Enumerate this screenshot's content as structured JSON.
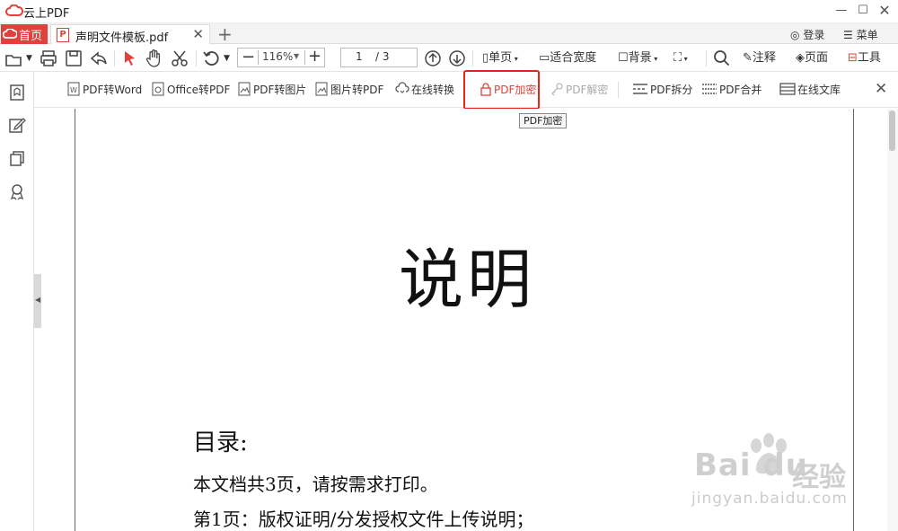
{
  "app": {
    "title": "云上PDF",
    "logo_icon": "cloud-logo-icon",
    "accent": "#e0413a"
  },
  "window": {
    "minimize_icon": "minimize-icon",
    "maximize_icon": "maximize-icon",
    "close_icon": "close-icon"
  },
  "tabs": {
    "home_label": "首页",
    "doc_label": "声明文件模板.pdf",
    "new_tab": "+",
    "login_label": "登录",
    "menu_label": "菜单"
  },
  "toolbar": {
    "zoom_value": "116%",
    "page_current": "1",
    "page_total": "/ 3",
    "single_page": "单页",
    "fit_width": "适合宽度",
    "background": "背景",
    "annotate": "注释",
    "page": "页面",
    "tools": "工具"
  },
  "subtoolbar": {
    "items": [
      {
        "label": "PDF转Word",
        "icon": "pdf-to-word-icon"
      },
      {
        "label": "Office转PDF",
        "icon": "office-to-pdf-icon"
      },
      {
        "label": "PDF转图片",
        "icon": "pdf-to-image-icon"
      },
      {
        "label": "图片转PDF",
        "icon": "image-to-pdf-icon"
      },
      {
        "label": "在线转换",
        "icon": "online-convert-icon"
      },
      {
        "label": "PDF加密",
        "icon": "lock-icon"
      },
      {
        "label": "PDF解密",
        "icon": "key-icon"
      },
      {
        "label": "PDF拆分",
        "icon": "split-icon"
      },
      {
        "label": "PDF合并",
        "icon": "merge-icon"
      },
      {
        "label": "在线文库",
        "icon": "library-icon"
      }
    ],
    "tooltip": "PDF加密",
    "highlight_color": "#e8231a"
  },
  "document": {
    "heading": "说明",
    "toc_title": "目录:",
    "lines": [
      "本文档共3页，请按需求打印。",
      "第1页：版权证明/分发授权文件上传说明；"
    ]
  },
  "watermark": {
    "brand": "Bai du",
    "jingyan": "经验",
    "url": "jingyan.baidu.com"
  }
}
